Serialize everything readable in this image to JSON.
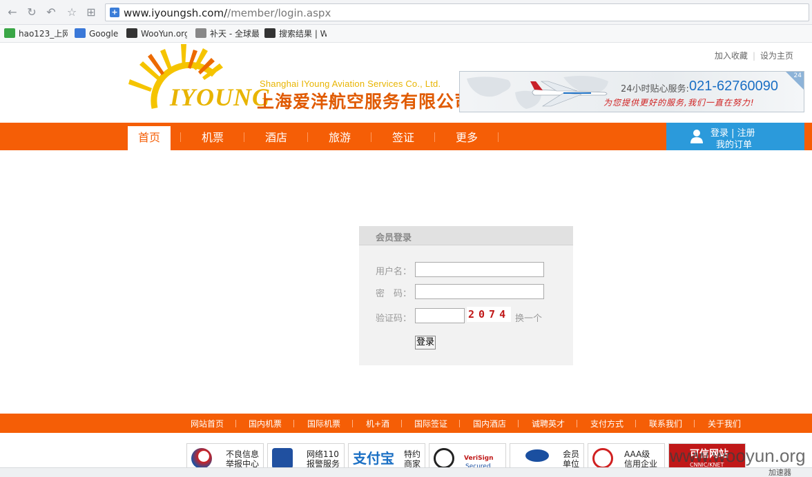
{
  "browser": {
    "url_main": "www.iyoungsh.com/",
    "url_rest": "/member/login.aspx",
    "bookmarks": [
      {
        "label": "hao123_上网",
        "color": "#3aa646"
      },
      {
        "label": "Google",
        "color": "#3a78d8"
      },
      {
        "label": "WooYun.org",
        "color": "#333333"
      },
      {
        "label": "补天 - 全球最",
        "color": "#888888"
      },
      {
        "label": "搜索结果 | W",
        "color": "#333333"
      }
    ],
    "status_text": "加速器"
  },
  "header": {
    "links": [
      "加入收藏",
      "设为主页"
    ],
    "logo_brand": "IYOUNG",
    "logo_en": "Shanghai IYoung Aviation Services Co., Ltd.",
    "logo_cn": "上海爱洋航空服务有限公司",
    "banner_label": "24小时贴心服务:",
    "banner_phone": "021-62760090",
    "banner_slogan": "为您提供更好的服务,我们一直在努力!",
    "banner_corner": "24"
  },
  "nav": {
    "items": [
      "首页",
      "机票",
      "酒店",
      "旅游",
      "签证",
      "更多"
    ],
    "active_index": 0,
    "login_line": "登录 | 注册",
    "orders_line": "我的订单"
  },
  "login": {
    "title": "会员登录",
    "username_label": "用户名：",
    "password_label": "密　码：",
    "captcha_label": "验证码：",
    "captcha_value": "2074",
    "refresh_label": "换一个",
    "submit_label": "登录"
  },
  "footer": {
    "links": [
      "网站首页",
      "国内机票",
      "国际机票",
      "机+酒",
      "国际签证",
      "国内酒店",
      "诚聘英才",
      "支付方式",
      "联系我们",
      "关于我们"
    ],
    "badges": [
      {
        "line1": "不良信息",
        "line2": "举报中心",
        "color": "#d02020"
      },
      {
        "line1": "网络110",
        "line2": "报警服务",
        "color": "#2050a0"
      },
      {
        "line1": "支付宝",
        "line2": "特约商家",
        "color": "#1a6fc4"
      },
      {
        "line1": "VeriSign",
        "line2": "Secured",
        "color": "#c01818"
      },
      {
        "line1": "会员",
        "line2": "单位",
        "color": "#1a4fa0"
      },
      {
        "line1": "AAA级",
        "line2": "信用企业",
        "color": "#d02020"
      },
      {
        "line1": "可信网站",
        "line2": "CNNIC/KNET",
        "color": "#d02020"
      }
    ],
    "watermark": "www.wooyun.org"
  }
}
